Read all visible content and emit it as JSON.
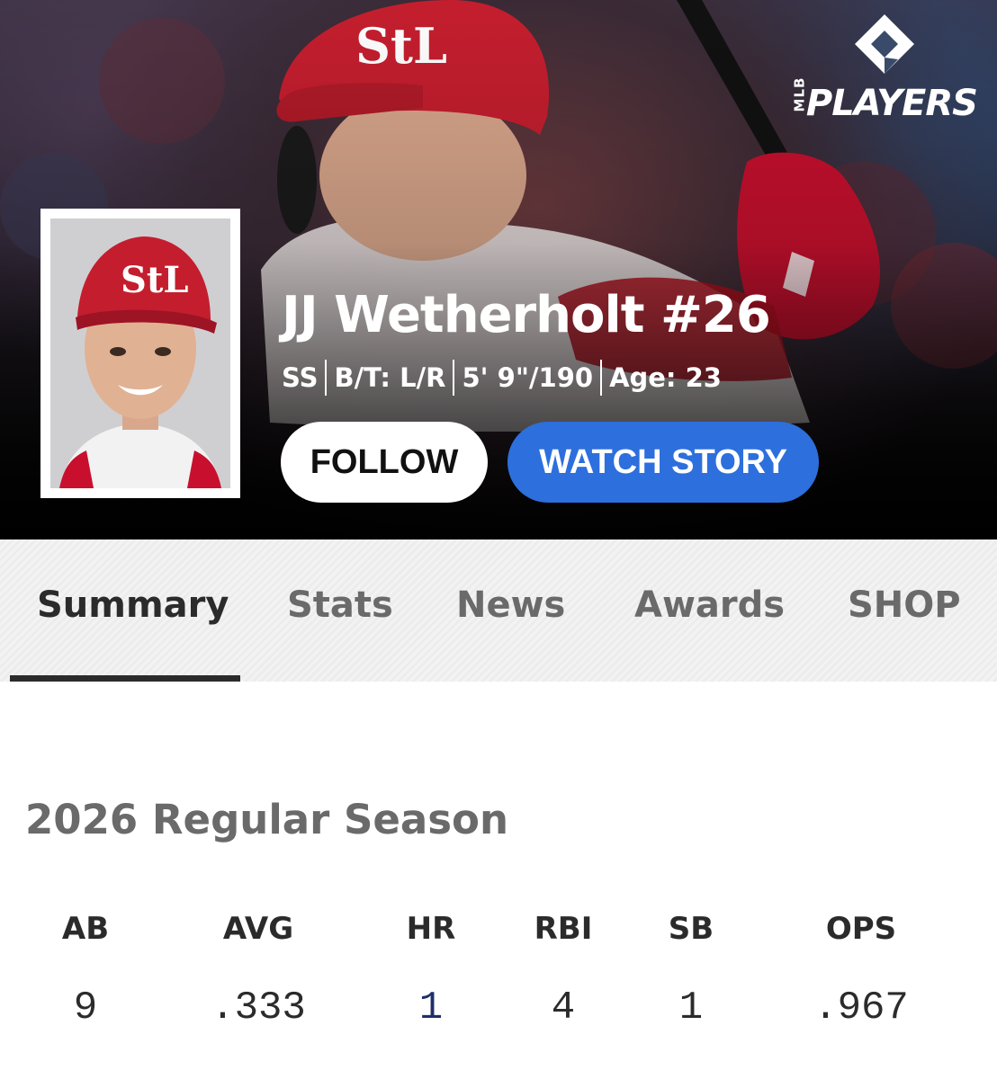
{
  "header": {
    "logo_text": "PLAYERS",
    "logo_sub": "MLB",
    "player_name": "JJ Wetherholt #26",
    "meta": [
      "SS",
      "B/T: L/R",
      "5' 9\"/190",
      "Age: 23"
    ],
    "follow_label": "FOLLOW",
    "watch_story_label": "WATCH STORY"
  },
  "tabs": [
    {
      "label": "Summary",
      "active": true
    },
    {
      "label": "Stats",
      "active": false
    },
    {
      "label": "News",
      "active": false
    },
    {
      "label": "Awards",
      "active": false
    },
    {
      "label": "SHOP",
      "active": false
    }
  ],
  "season": {
    "title": "2026 Regular Season",
    "stats": [
      {
        "label": "AB",
        "value": "9"
      },
      {
        "label": "AVG",
        "value": ".333"
      },
      {
        "label": "HR",
        "value": "1"
      },
      {
        "label": "RBI",
        "value": "4"
      },
      {
        "label": "SB",
        "value": "1"
      },
      {
        "label": "OPS",
        "value": ".967"
      }
    ]
  },
  "colors": {
    "accent_blue": "#2d6fdc",
    "cardinals_red": "#c8102e",
    "text_dark": "#2b2b2b",
    "text_muted": "#6a6a6a"
  }
}
